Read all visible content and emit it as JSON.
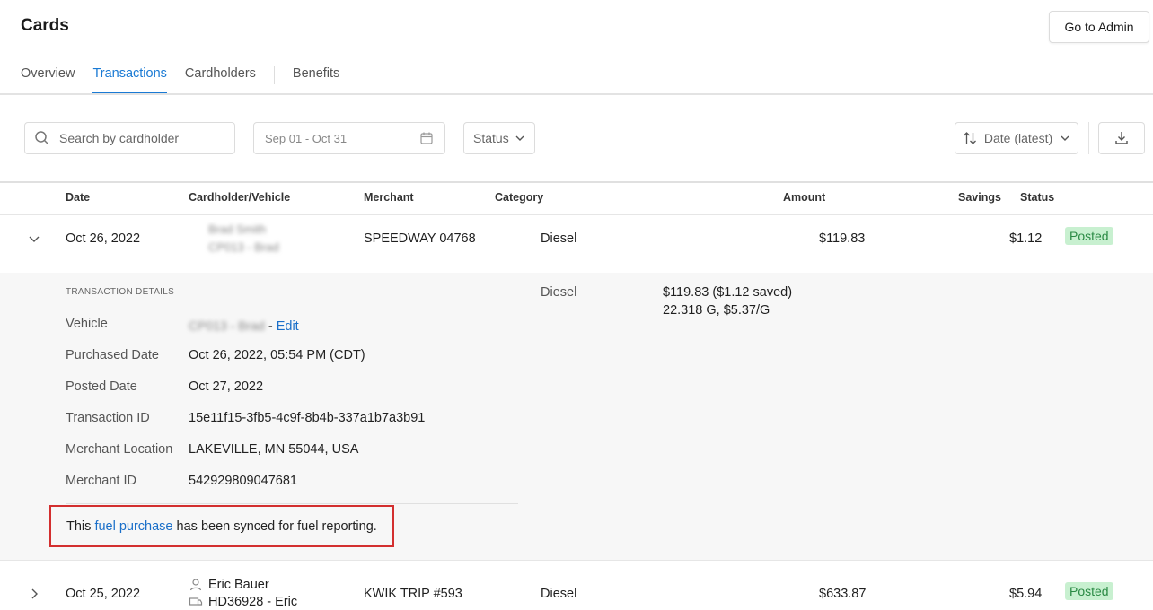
{
  "page_title": "Cards",
  "admin_button": "Go to Admin",
  "tabs": [
    {
      "label": "Overview"
    },
    {
      "label": "Transactions"
    },
    {
      "label": "Cardholders"
    },
    {
      "label": "Benefits"
    }
  ],
  "filters": {
    "search_placeholder": "Search by cardholder",
    "date_range": "Sep 01 - Oct 31",
    "status_label": "Status",
    "sort_label": "Date (latest)"
  },
  "table_headers": {
    "date": "Date",
    "cardholder": "Cardholder/Vehicle",
    "merchant": "Merchant",
    "category": "Category",
    "amount": "Amount",
    "savings": "Savings",
    "status": "Status"
  },
  "rows": [
    {
      "date": "Oct 26, 2022",
      "cardholder_name": "Brad Smith",
      "vehicle": "CP013 - Brad",
      "merchant": "SPEEDWAY 04768",
      "category": "Diesel",
      "amount": "$119.83",
      "savings": "$1.12",
      "status": "Posted"
    },
    {
      "date": "Oct 25, 2022",
      "cardholder_name": "Eric Bauer",
      "vehicle": "HD36928 - Eric",
      "merchant": "KWIK TRIP #593",
      "category": "Diesel",
      "amount": "$633.87",
      "savings": "$5.94",
      "status": "Posted"
    }
  ],
  "details": {
    "section_title": "TRANSACTION DETAILS",
    "category": "Diesel",
    "amount_line1": "$119.83 ($1.12 saved)",
    "amount_line2": "22.318 G, $5.37/G",
    "fields": [
      {
        "label": "Vehicle",
        "value": "CP013 - Brad"
      },
      {
        "label": "Purchased Date",
        "value": "Oct 26, 2022, 05:54 PM (CDT)"
      },
      {
        "label": "Posted Date",
        "value": "Oct 27, 2022"
      },
      {
        "label": "Transaction ID",
        "value": "15e11f15-3fb5-4c9f-8b4b-337a1b7a3b91"
      },
      {
        "label": "Merchant Location",
        "value": "LAKEVILLE, MN 55044, USA"
      },
      {
        "label": "Merchant ID",
        "value": "542929809047681"
      }
    ],
    "edit_link": "Edit",
    "edit_sep": " - ",
    "notice_prefix": "This ",
    "notice_link": "fuel purchase",
    "notice_suffix": " has been synced for fuel reporting."
  }
}
